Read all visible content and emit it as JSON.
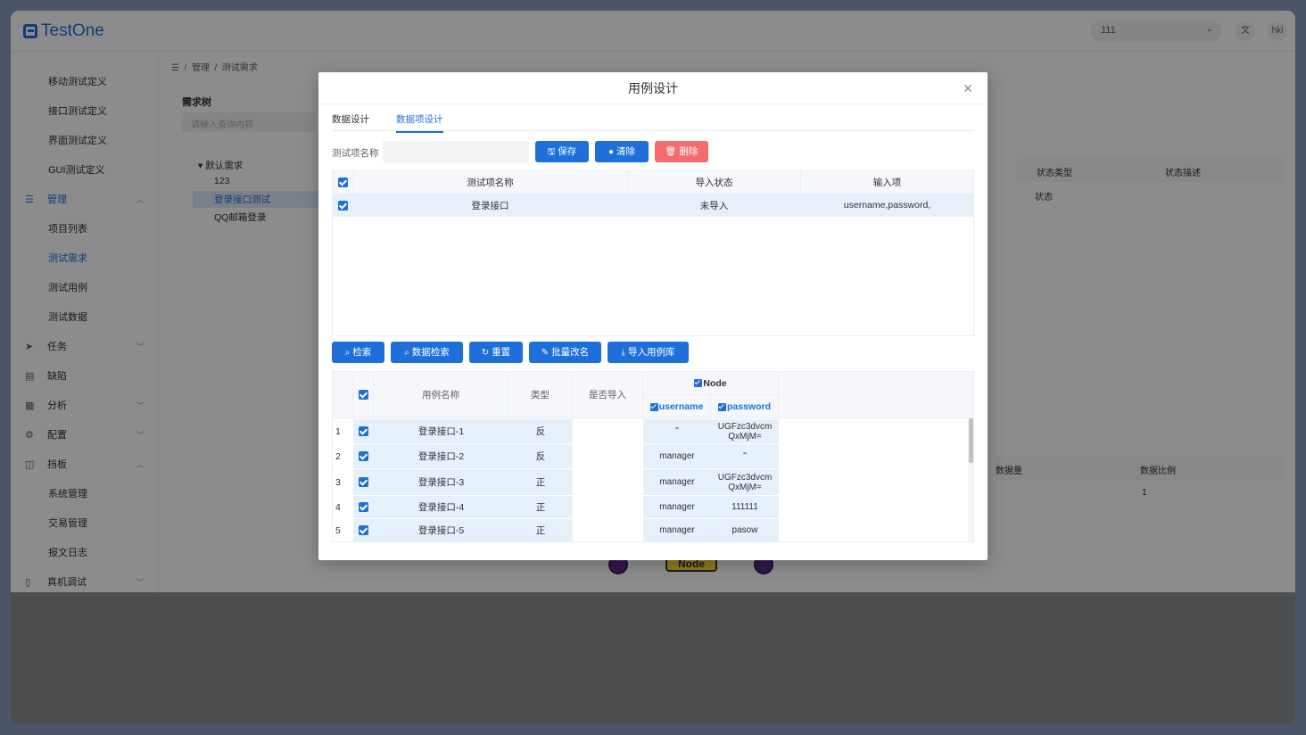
{
  "app": {
    "logo_text": "TestOne",
    "project_select": "111",
    "translate_icon": "文",
    "user": "hkl"
  },
  "sidebar": {
    "items": [
      {
        "label": "移动测试定义",
        "sub": true
      },
      {
        "label": "接口测试定义",
        "sub": true
      },
      {
        "label": "界面测试定义",
        "sub": true
      },
      {
        "label": "GUI测试定义",
        "sub": true
      },
      {
        "label": "管理",
        "sub": false,
        "icon": "list-icon",
        "active": true,
        "arrow": "^"
      },
      {
        "label": "项目列表",
        "sub": true
      },
      {
        "label": "测试需求",
        "sub": true,
        "active": true
      },
      {
        "label": "测试用例",
        "sub": true
      },
      {
        "label": "测试数据",
        "sub": true
      },
      {
        "label": "任务",
        "sub": false,
        "icon": "send-icon",
        "arrow": "v"
      },
      {
        "label": "缺陷",
        "sub": false,
        "icon": "doc-icon"
      },
      {
        "label": "分析",
        "sub": false,
        "icon": "calendar-icon",
        "arrow": "v"
      },
      {
        "label": "配置",
        "sub": false,
        "icon": "gear-icon",
        "arrow": "v"
      },
      {
        "label": "挡板",
        "sub": false,
        "icon": "panel-icon",
        "arrow": "^"
      },
      {
        "label": "系统管理",
        "sub": true
      },
      {
        "label": "交易管理",
        "sub": true
      },
      {
        "label": "报文日志",
        "sub": true
      },
      {
        "label": "真机调试",
        "sub": false,
        "icon": "device-icon",
        "arrow": "v"
      }
    ]
  },
  "breadcrumb": {
    "part1": "管理",
    "sep": "/",
    "part2": "测试需求"
  },
  "tree": {
    "title": "需求树",
    "search_placeholder": "请输入查询内容",
    "root": "默认需求",
    "children": [
      "123",
      "登录接口测试",
      "QQ邮箱登录"
    ]
  },
  "background_right": {
    "col1": "状态类型",
    "col2": "状态描述",
    "val1": "状态",
    "col3": "数据量",
    "col4": "数据比例",
    "val4": "1"
  },
  "graph_node_label": "Node",
  "dialog": {
    "title": "用例设计",
    "tabs": [
      "数据设计",
      "数据项设计"
    ],
    "form": {
      "label": "测试项名称",
      "value": "",
      "placeholder": ""
    },
    "buttons": {
      "save": "保存",
      "clear": "清除",
      "delete": "删除",
      "search": "检索",
      "data_search": "数据检索",
      "reset": "重置",
      "batch_rename": "批量改名",
      "import_lib": "导入用例库"
    },
    "top_table": {
      "headers": [
        "测试项名称",
        "导入状态",
        "输入项"
      ],
      "rows": [
        {
          "name": "登录接口",
          "status": "未导入",
          "inputs": "username,password,"
        }
      ]
    },
    "bottom_table": {
      "headers": {
        "name": "用例名称",
        "type": "类型",
        "imported": "是否导入",
        "group": "Node",
        "col_a": "username",
        "col_b": "password"
      },
      "rows": [
        {
          "idx": "1",
          "name": "登录接口-1",
          "type": "反",
          "imported": "",
          "username": "''",
          "password": "UGFzc3dvcm QxMjM="
        },
        {
          "idx": "2",
          "name": "登录接口-2",
          "type": "反",
          "imported": "",
          "username": "manager",
          "password": "''"
        },
        {
          "idx": "3",
          "name": "登录接口-3",
          "type": "正",
          "imported": "",
          "username": "manager",
          "password": "UGFzc3dvcm QxMjM="
        },
        {
          "idx": "4",
          "name": "登录接口-4",
          "type": "正",
          "imported": "",
          "username": "manager",
          "password": "111111"
        },
        {
          "idx": "5",
          "name": "登录接口-5",
          "type": "正",
          "imported": "",
          "username": "manager",
          "password": "pasow"
        }
      ]
    }
  }
}
